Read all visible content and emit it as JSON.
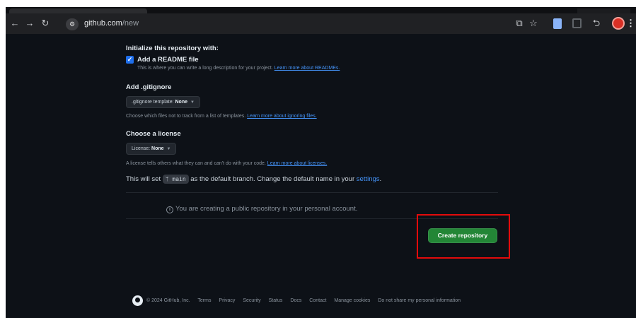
{
  "browser": {
    "url_host": "github.com",
    "url_path": "/new",
    "icons": [
      "back-arrow-icon",
      "forward-arrow-icon",
      "reload-icon",
      "site-settings-icon",
      "cast-icon",
      "bookmark-star-icon",
      "extension-doc-icon",
      "extension-save-icon",
      "extensions-puzzle-icon",
      "profile-avatar-icon",
      "menu-kebab-icon"
    ]
  },
  "form": {
    "init_title": "Initialize this repository with:",
    "readme": {
      "checked": true,
      "label": "Add a README file",
      "desc": "This is where you can write a long description for your project. ",
      "link": "Learn more about READMEs."
    },
    "gitignore": {
      "title": "Add .gitignore",
      "dropdown_prefix": ".gitignore template: ",
      "dropdown_value": "None",
      "desc": "Choose which files not to track from a list of templates. ",
      "link": "Learn more about ignoring files."
    },
    "license": {
      "title": "Choose a license",
      "dropdown_prefix": "License: ",
      "dropdown_value": "None",
      "desc": "A license tells others what they can and can't do with your code. ",
      "link": "Learn more about licenses."
    },
    "branch": {
      "prefix": "This will set ",
      "branch_name": "main",
      "suffix": " as the default branch. Change the default name in your ",
      "settings_link": "settings",
      "end": "."
    },
    "info": "You are creating a public repository in your personal account.",
    "create_button": "Create repository"
  },
  "footer": {
    "copyright": "© 2024 GitHub, Inc.",
    "links": [
      "Terms",
      "Privacy",
      "Security",
      "Status",
      "Docs",
      "Contact",
      "Manage cookies",
      "Do not share my personal information"
    ]
  },
  "colors": {
    "background": "#0d1117",
    "button": "#238636",
    "link": "#4493f8",
    "highlight": "#e30b0b"
  }
}
